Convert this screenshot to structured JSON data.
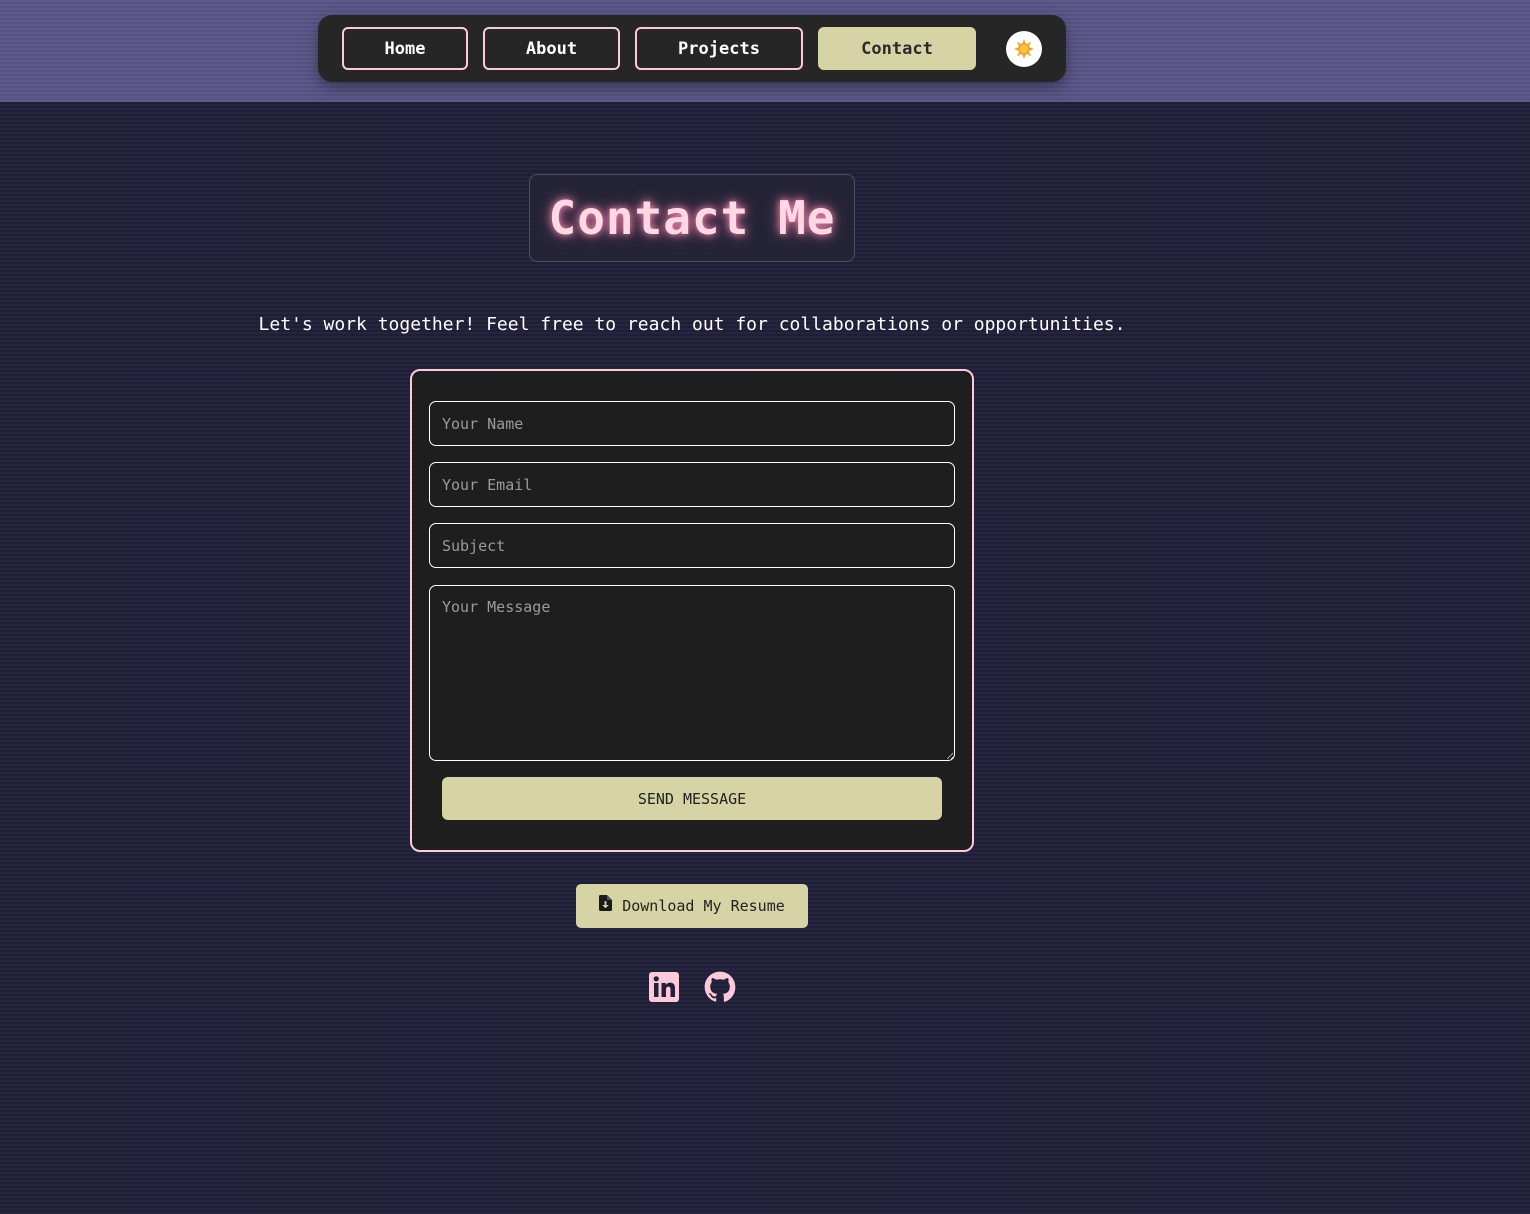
{
  "nav": {
    "items": [
      {
        "label": "Home"
      },
      {
        "label": "About"
      },
      {
        "label": "Projects"
      },
      {
        "label": "Contact",
        "active": true
      }
    ],
    "theme_toggle_icon": "sun-icon"
  },
  "page": {
    "title": "Contact Me",
    "tagline": "Let's work together! Feel free to reach out for collaborations or opportunities."
  },
  "form": {
    "name_placeholder": "Your Name",
    "name_value": "",
    "email_placeholder": "Your Email",
    "email_value": "",
    "subject_placeholder": "Subject",
    "subject_value": "",
    "message_placeholder": "Your Message",
    "message_value": "",
    "submit_label": "SEND MESSAGE"
  },
  "resume": {
    "label": "Download My Resume",
    "icon": "file-download-icon"
  },
  "social": [
    {
      "name": "linkedin",
      "icon": "linkedin-icon"
    },
    {
      "name": "github",
      "icon": "github-icon"
    }
  ],
  "colors": {
    "background": "#20203a",
    "header_band": "#5a5487",
    "nav_bg": "#262626",
    "accent_pink": "#ffc9d8",
    "accent_khaki": "#d6d4a4",
    "card_bg": "#1e1e1e"
  }
}
